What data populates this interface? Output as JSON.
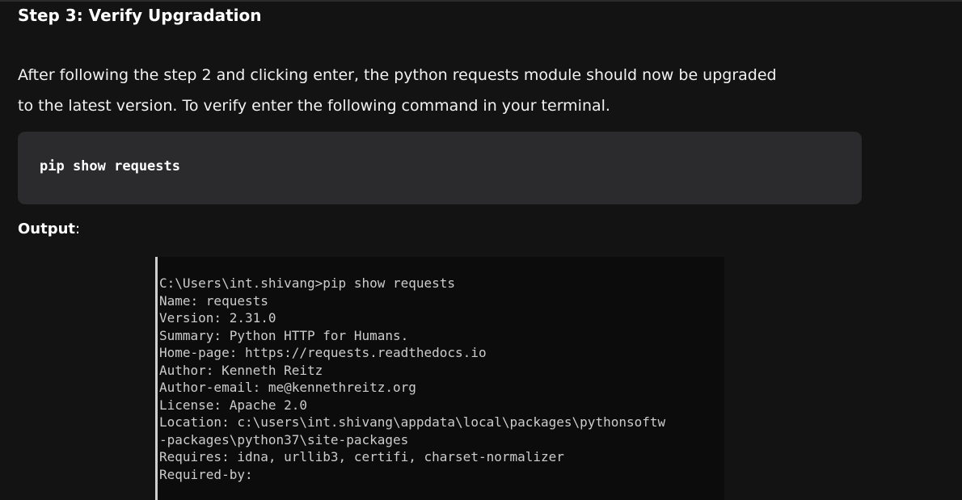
{
  "article": {
    "heading": "Step 3: Verify Upgradation",
    "paragraph_line1": "After following the step 2 and clicking enter, the python requests module should now be upgraded",
    "paragraph_line2": "to the latest version. To verify enter the following command in your terminal.",
    "code_command": "pip show requests",
    "output_label": "Output",
    "output_label_suffix": ":"
  },
  "terminal": {
    "lines": [
      "C:\\Users\\int.shivang>pip show requests",
      "Name: requests",
      "Version: 2.31.0",
      "Summary: Python HTTP for Humans.",
      "Home-page: https://requests.readthedocs.io",
      "Author: Kenneth Reitz",
      "Author-email: me@kennethreitz.org",
      "License: Apache 2.0",
      "Location: c:\\users\\int.shivang\\appdata\\local\\packages\\pythonsoftw",
      "-packages\\python37\\site-packages",
      "Requires: idna, urllib3, certifi, charset-normalizer",
      "Required-by:"
    ]
  },
  "colors": {
    "page_background": "#131313",
    "code_block_background": "#2b2b2e",
    "terminal_background": "#0c0c0c",
    "terminal_text": "#cccccc"
  }
}
